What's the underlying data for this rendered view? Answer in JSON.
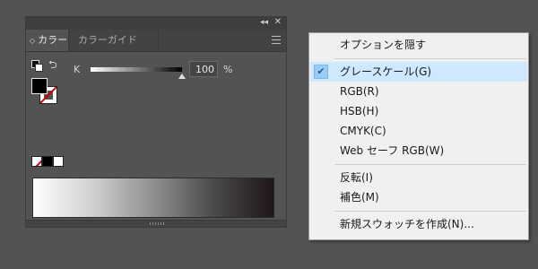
{
  "panel": {
    "collapse_glyph": "◂◂",
    "close_glyph": "✕",
    "tabs": [
      {
        "label": "カラー",
        "active": true,
        "updown_glyph": "◇"
      },
      {
        "label": "カラーガイド",
        "active": false
      }
    ],
    "menu_icon": "hamburger-icon",
    "swap_glyph": "⮌",
    "slider": {
      "label": "K",
      "value": "100",
      "unit": "%",
      "level": 1.0
    },
    "colors": {
      "fill": "#000000",
      "stroke": "none",
      "panel_bg": "#535353"
    }
  },
  "menu": {
    "check_glyph": "✔",
    "items": [
      {
        "label": "オプションを隠す",
        "checked": false
      },
      {
        "label": "グレースケール(G)",
        "checked": true
      },
      {
        "label": "RGB(R)",
        "checked": false
      },
      {
        "label": "HSB(H)",
        "checked": false
      },
      {
        "label": "CMYK(C)",
        "checked": false
      },
      {
        "label": "Web セーフ RGB(W)",
        "checked": false
      },
      {
        "label": "反転(I)",
        "checked": false
      },
      {
        "label": "補色(M)",
        "checked": false
      },
      {
        "label": "新規スウォッチを作成(N)...",
        "checked": false
      }
    ]
  }
}
